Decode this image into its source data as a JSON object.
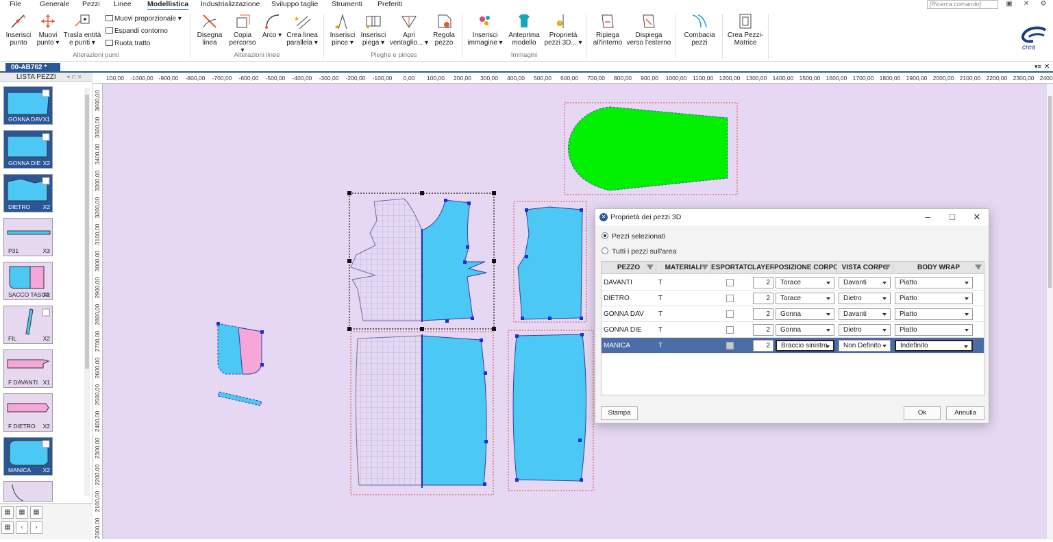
{
  "menu": {
    "items": [
      "File",
      "Generale",
      "Pezzi",
      "Linee",
      "Modellistica",
      "Industrializzazione",
      "Sviluppo taglie",
      "Strumenti",
      "Preferiti"
    ],
    "active": "Modellistica",
    "search_placeholder": "[Ricerca comando]"
  },
  "ribbon": {
    "alterazioni_punti": {
      "label": "Alterazioni punti",
      "inserisci_punto": "Inserisci punto",
      "muovi_punto": "Muovi punto ▾",
      "trasla": "Trasla entità e punti ▾",
      "muovi_proporzionale": "Muovi proporzionale",
      "espandi_contorno": "Espandi contorno",
      "ruota_tratto": "Ruota tratto"
    },
    "alterazioni_linee": {
      "label": "Alterazioni linee",
      "disegna_linea": "Disegna linea",
      "copia_percorso": "Copia percorso ▾",
      "arco": "Arco ▾",
      "crea_linea_parallela": "Crea linea parallela ▾"
    },
    "pieghe_pinces": {
      "label": "Pieghe e pinces",
      "inserisci_pince": "Inserisci pince ▾",
      "inserisci_piega": "Inserisci piega ▾",
      "apri_ventaglio": "Apri ventaglio... ▾",
      "regola_pezzo": "Regola pezzo"
    },
    "immagini": {
      "label": "Immagini",
      "inserisci_immagine": "Inserisci immagine ▾",
      "anteprima_modello": "Anteprima modello",
      "proprieta_pezzi": "Proprietà pezzi 3D... ▾"
    },
    "altro": {
      "ripiega_interno": "Ripiega all'interno",
      "dispiega_esterno": "Dispiega verso l'esterno",
      "combacia_pezzi": "Combacia pezzi",
      "crea_pezzi_matrice": "Crea Pezzi-Matrice"
    },
    "logo": "crea"
  },
  "document": {
    "tab": "00-AB762 *"
  },
  "panel": {
    "title": "LISTA PEZZI",
    "pieces": [
      {
        "name": "GONNA DAV",
        "qty": "X1",
        "selected": true
      },
      {
        "name": "GONNA DIE",
        "qty": "X2",
        "selected": true
      },
      {
        "name": "DIETRO",
        "qty": "X2",
        "selected": true
      },
      {
        "name": "P31",
        "qty": "X3",
        "selected": false
      },
      {
        "name": "SACCO TASCA",
        "qty": "X2",
        "selected": false
      },
      {
        "name": "FIL",
        "qty": "X2",
        "selected": false
      },
      {
        "name": "F DAVANTI",
        "qty": "X1",
        "selected": false
      },
      {
        "name": "F DIETRO",
        "qty": "X2",
        "selected": false
      },
      {
        "name": "MANICA",
        "qty": "X2",
        "selected": true
      }
    ]
  },
  "ruler": {
    "top": [
      "100,00",
      "-1000,00",
      "-900,00",
      "-800,00",
      "-700,00",
      "-600,00",
      "-500,00",
      "-400,00",
      "-300,00",
      "-200,00",
      "-100,00",
      "0,00",
      "100,00",
      "200,00",
      "300,00",
      "400,00",
      "500,00",
      "600,00",
      "700,00",
      "800,00",
      "900,00",
      "1000,00",
      "1100,00",
      "1200,00",
      "1300,00",
      "1400,00",
      "1500,00",
      "1600,00",
      "1700,00",
      "1800,00",
      "1900,00",
      "2000,00",
      "2100,00",
      "2200,00",
      "2300,00",
      "2400,00"
    ],
    "left": [
      "3600,00",
      "3500,00",
      "3400,00",
      "3300,00",
      "3200,00",
      "3100,00",
      "3000,00",
      "2900,00",
      "2800,00",
      "2700,00",
      "2600,00",
      "2500,00",
      "2400,00",
      "2300,00",
      "2200,00",
      "2100,00",
      "2000,00"
    ]
  },
  "dialog": {
    "title": "Proprietà dei pezzi 3D",
    "radio_selected": "Pezzi selezionati",
    "radio_all": "Tutti i pezzi sull'area",
    "columns": [
      "PEZZO",
      "MATERIALI",
      "ESPORTATO",
      "LAYER",
      "POSIZIONE CORPO",
      "VISTA CORPO",
      "BODY WRAP"
    ],
    "rows": [
      {
        "pezzo": "DAVANTI",
        "materiali": "T",
        "layer": "2",
        "posizione": "Torace",
        "vista": "Davanti",
        "wrap": "Piatto"
      },
      {
        "pezzo": "DIETRO",
        "materiali": "T",
        "layer": "2",
        "posizione": "Torace",
        "vista": "Dietro",
        "wrap": "Piatto"
      },
      {
        "pezzo": "GONNA DAV",
        "materiali": "T",
        "layer": "2",
        "posizione": "Gonna",
        "vista": "Davanti",
        "wrap": "Piatto"
      },
      {
        "pezzo": "GONNA DIE",
        "materiali": "T",
        "layer": "2",
        "posizione": "Gonna",
        "vista": "Dietro",
        "wrap": "Piatto"
      },
      {
        "pezzo": "MANICA",
        "materiali": "T",
        "layer": "2",
        "posizione": "Braccio sinistro",
        "vista": "Non Definito",
        "wrap": "Indefinito"
      }
    ],
    "stampa": "Stampa",
    "ok": "Ok",
    "annulla": "Annulla"
  },
  "colors": {
    "accent": "#2b5797",
    "piece_blue": "#4cc8f5",
    "piece_green": "#00f000",
    "canvas": "#e6d8f3",
    "pink": "#f4a7d8"
  }
}
